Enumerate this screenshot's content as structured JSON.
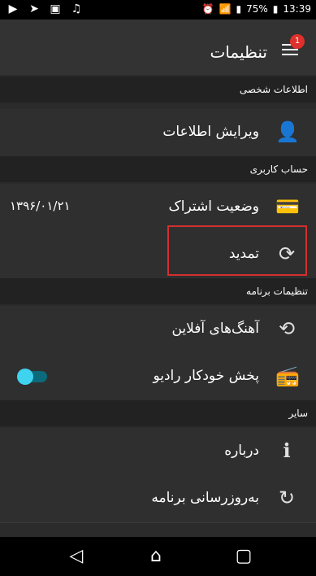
{
  "status_bar": {
    "time": "13:39",
    "battery_percent": "75%",
    "icons": [
      "circle-play-icon",
      "navigation-icon",
      "image-icon",
      "music-note-icon",
      "alarm-icon",
      "wifi-icon",
      "signal-icon",
      "battery-icon"
    ]
  },
  "app_bar": {
    "title": "تنظیمات",
    "notification_count": "1"
  },
  "sections": [
    {
      "title": "اطلاعات شخصی"
    },
    {
      "title": "حساب کاربری"
    },
    {
      "title": "تنظیمات برنامه"
    },
    {
      "title": "سایر"
    }
  ],
  "items": {
    "edit_info": "ویرایش اطلاعات",
    "subscription_status": "وضعیت اشتراک",
    "subscription_date": "۱۳۹۶/۰۱/۲۱",
    "renew": "تمدید",
    "offline_songs": "آهنگ‌های آفلاین",
    "auto_radio": "پخش خودکار رادیو",
    "about": "درباره",
    "update": "به‌روزرسانی برنامه"
  },
  "toggles": {
    "auto_radio_enabled": true
  },
  "colors": {
    "accent": "#3fd3f0",
    "highlight_border": "#d32f2f",
    "badge": "#e0302b"
  }
}
